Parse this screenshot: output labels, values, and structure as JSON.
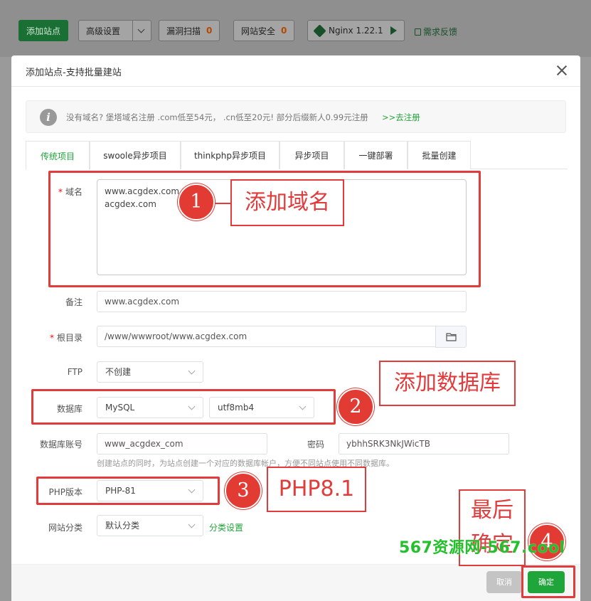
{
  "toolbar": {
    "add_site": "添加站点",
    "advanced": "高级设置",
    "vuln_scan": "漏洞扫描",
    "vuln_count": "0",
    "web_security": "网站安全",
    "security_count": "0",
    "nginx": "Nginx 1.22.1",
    "feedback": "需求反馈"
  },
  "modal": {
    "title": "添加站点-支持批量建站",
    "notice": "没有域名? 堡塔域名注册 .com低至54元， .cn低至20元! 部分后缀新人0.99元注册",
    "notice_link": ">>去注册",
    "tabs": [
      "传统项目",
      "swoole异步项目",
      "thinkphp异步项目",
      "异步项目",
      "一键部署",
      "批量创建"
    ],
    "form": {
      "domain_label": "域名",
      "domains": [
        "www.acgdex.com",
        "acgdex.com"
      ],
      "remark_label": "备注",
      "remark_value": "www.acgdex.com",
      "root_label": "根目录",
      "root_value": "/www/wwwroot/www.acgdex.com",
      "ftp_label": "FTP",
      "ftp_value": "不创建",
      "db_label": "数据库",
      "db_type": "MySQL",
      "db_charset": "utf8mb4",
      "db_account_label": "数据库账号",
      "db_account_value": "www_acgdex_com",
      "password_label": "密码",
      "password_value": "ybhhSRK3NkJWicTB",
      "db_hint": "创建站点的同时，为站点创建一个对应的数据库帐户，方便不同站点使用不同数据库。",
      "php_label": "PHP版本",
      "php_value": "PHP-81",
      "category_label": "网站分类",
      "category_value": "默认分类",
      "category_link": "分类设置"
    },
    "cancel": "取消",
    "confirm": "确定"
  },
  "annotations": {
    "step1": "1",
    "step1_text": "添加域名",
    "step2": "2",
    "step2_text": "添加数据库",
    "step3": "3",
    "step3_text": "PHP8.1",
    "step4": "4",
    "step4_text_line1": "最后",
    "step4_text_line2": "确定",
    "watermark": "567资源网-567.cool"
  }
}
